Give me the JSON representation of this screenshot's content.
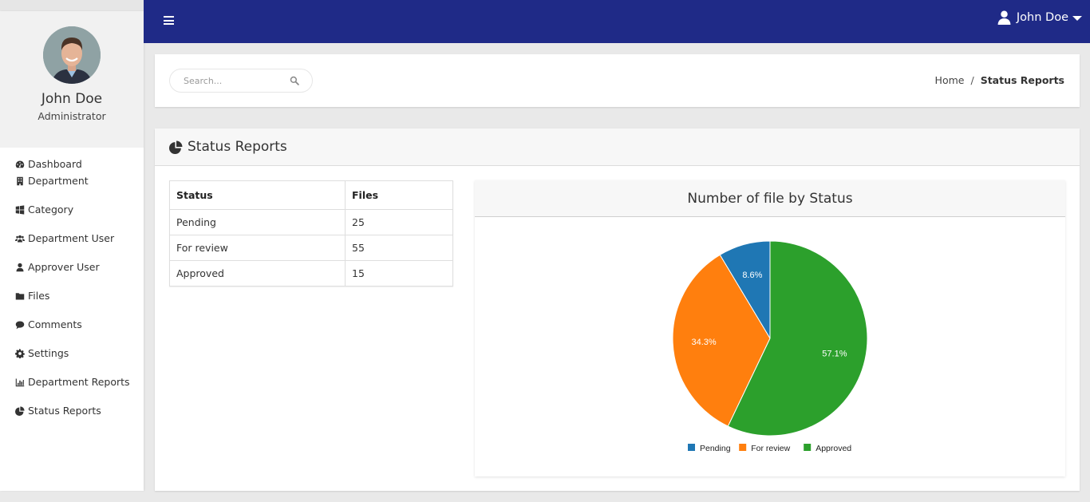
{
  "sidebar": {
    "profile": {
      "name": "John Doe",
      "role": "Administrator"
    },
    "items": [
      {
        "label": "Dashboard",
        "icon": "tachometer-icon"
      },
      {
        "label": "Department",
        "icon": "building-icon"
      },
      {
        "label": "Category",
        "icon": "windows-icon"
      },
      {
        "label": "Department User",
        "icon": "users-icon"
      },
      {
        "label": "Approver User",
        "icon": "user-icon"
      },
      {
        "label": "Files",
        "icon": "folder-icon"
      },
      {
        "label": "Comments",
        "icon": "comment-icon"
      },
      {
        "label": "Settings",
        "icon": "gear-icon"
      },
      {
        "label": "Department Reports",
        "icon": "bar-chart-icon"
      },
      {
        "label": "Status Reports",
        "icon": "pie-chart-icon"
      }
    ]
  },
  "topnav": {
    "user_name": "John Doe"
  },
  "search": {
    "placeholder": "Search..."
  },
  "breadcrumb": {
    "home": "Home",
    "separator": "/",
    "current": "Status Reports"
  },
  "page": {
    "title": "Status Reports",
    "table": {
      "headers": [
        "Status",
        "Files"
      ],
      "rows": [
        {
          "status": "Pending",
          "files": "25"
        },
        {
          "status": "For review",
          "files": "55"
        },
        {
          "status": "Approved",
          "files": "15"
        }
      ]
    }
  },
  "colors": {
    "nav": "#1f2a87",
    "pending": "#1f77b4",
    "for_review": "#ff7f0e",
    "approved": "#2ca02c"
  },
  "chart_data": {
    "type": "pie",
    "title": "Number of file by Status",
    "categories": [
      "Pending",
      "For review",
      "Approved"
    ],
    "values": [
      8.6,
      34.3,
      57.1
    ],
    "value_labels": [
      "8.6%",
      "34.3%",
      "57.1%"
    ],
    "colors": [
      "#1f77b4",
      "#ff7f0e",
      "#2ca02c"
    ],
    "legend": "bottom"
  }
}
